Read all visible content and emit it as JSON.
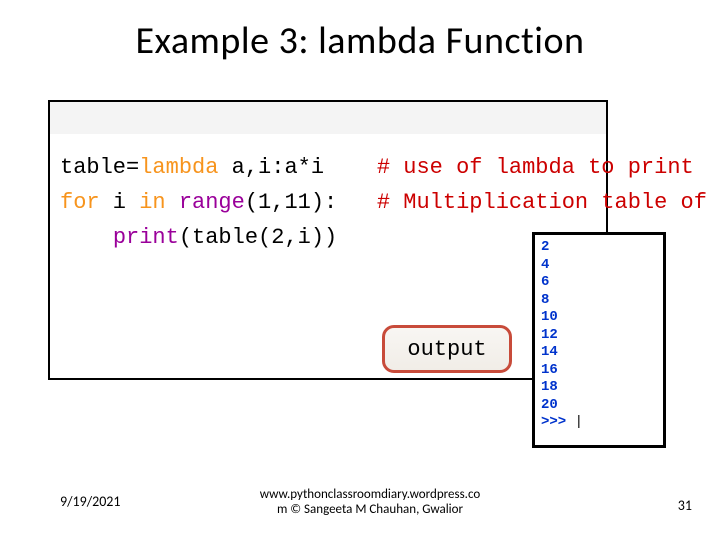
{
  "title": "Example 3: lambda Function",
  "code": {
    "line1": {
      "var": "table",
      "eq": "=",
      "kw": "lambda",
      "args": " a,i:a*i",
      "gap": "    ",
      "cmt": "# use of lambda to print"
    },
    "line2": {
      "kw": "for",
      "mid": " i ",
      "kw2": "in",
      "sp": " ",
      "fn": "range",
      "args": "(1,11):",
      "gap": "   ",
      "cmt": "# Multiplication table of a"
    },
    "line3": {
      "indent": "    ",
      "fn": "print",
      "call": "(table(2,i))"
    }
  },
  "output_label": "output",
  "output_values": [
    "2",
    "4",
    "6",
    "8",
    "10",
    "12",
    "14",
    "16",
    "18",
    "20"
  ],
  "prompt": ">>> ",
  "cursor": "|",
  "footer": {
    "date": "9/19/2021",
    "attr_line1": "www.pythonclassroomdiary.wordpress.co",
    "attr_line2": "m  © Sangeeta M Chauhan, Gwalior",
    "pagenum": "31"
  }
}
